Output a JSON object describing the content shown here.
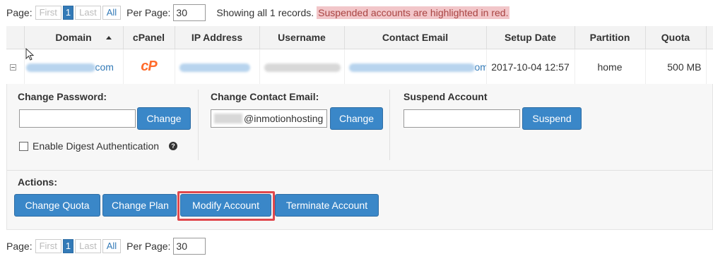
{
  "pager": {
    "page_label": "Page:",
    "first": "First",
    "current": "1",
    "last": "Last",
    "all": "All",
    "per_page_label": "Per Page:",
    "per_page_value": "30"
  },
  "status": {
    "showing": "Showing all 1 records.",
    "suspended_note": "Suspended accounts are highlighted in red."
  },
  "table": {
    "headers": [
      "Domain",
      "cPanel",
      "IP Address",
      "Username",
      "Contact Email",
      "Setup Date",
      "Partition",
      "Quota"
    ],
    "row": {
      "domain_suffix": "com",
      "cpanel_icon": "cP",
      "email_suffix": "om",
      "setup_date": "2017-10-04 12:57",
      "partition": "home",
      "quota": "500 MB"
    }
  },
  "panel": {
    "change_password": {
      "title": "Change Password:",
      "button": "Change",
      "digest_label": "Enable Digest Authentication"
    },
    "change_email": {
      "title": "Change Contact Email:",
      "value_suffix": "@inmotionhosting",
      "button": "Change"
    },
    "suspend": {
      "title": "Suspend Account",
      "button": "Suspend"
    },
    "actions": {
      "title": "Actions:",
      "buttons": [
        "Change Quota",
        "Change Plan",
        "Modify Account",
        "Terminate Account"
      ]
    }
  },
  "colors": {
    "accent": "#3a87c8",
    "suspended_bg": "#f2c6c9",
    "highlight": "#e0484d",
    "cpanel_brand": "#ff6c2c"
  }
}
